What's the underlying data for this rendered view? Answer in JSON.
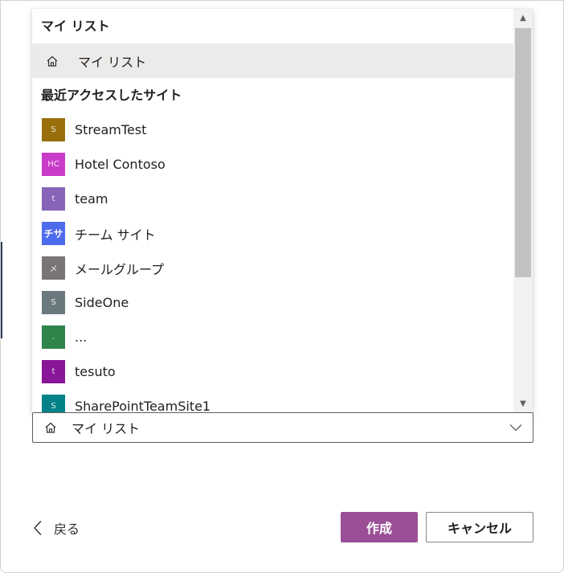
{
  "popup": {
    "my_list_group": "マイ リスト",
    "my_list_option": {
      "label": "マイ リスト",
      "icon": "home-icon"
    },
    "recent_group": "最近アクセスしたサイト",
    "sites": [
      {
        "label": "StreamTest",
        "initials": "S",
        "color": "#986f0b"
      },
      {
        "label": "Hotel Contoso",
        "initials": "HC",
        "color": "#c93cc9"
      },
      {
        "label": "team",
        "initials": "t",
        "color": "#8764b8"
      },
      {
        "label": "チーム サイト",
        "initials": "チサ",
        "color": "#4f6bed"
      },
      {
        "label": "メールグループ",
        "initials": "メ",
        "color": "#7a7574"
      },
      {
        "label": "SideOne",
        "initials": "S",
        "color": "#69797e"
      },
      {
        "label": "...",
        "initials": ".",
        "color": "#2e844a"
      },
      {
        "label": "tesuto",
        "initials": "t",
        "color": "#881798"
      },
      {
        "label": "SharePointTeamSite1",
        "initials": "S",
        "color": "#038387"
      }
    ]
  },
  "field": {
    "selected_label": "マイ リスト",
    "icon": "home-icon"
  },
  "footer": {
    "back_label": "戻る",
    "create_label": "作成",
    "cancel_label": "キャンセル"
  },
  "colors": {
    "accent": "#9b4f96",
    "selected_bg": "#edebe9"
  }
}
